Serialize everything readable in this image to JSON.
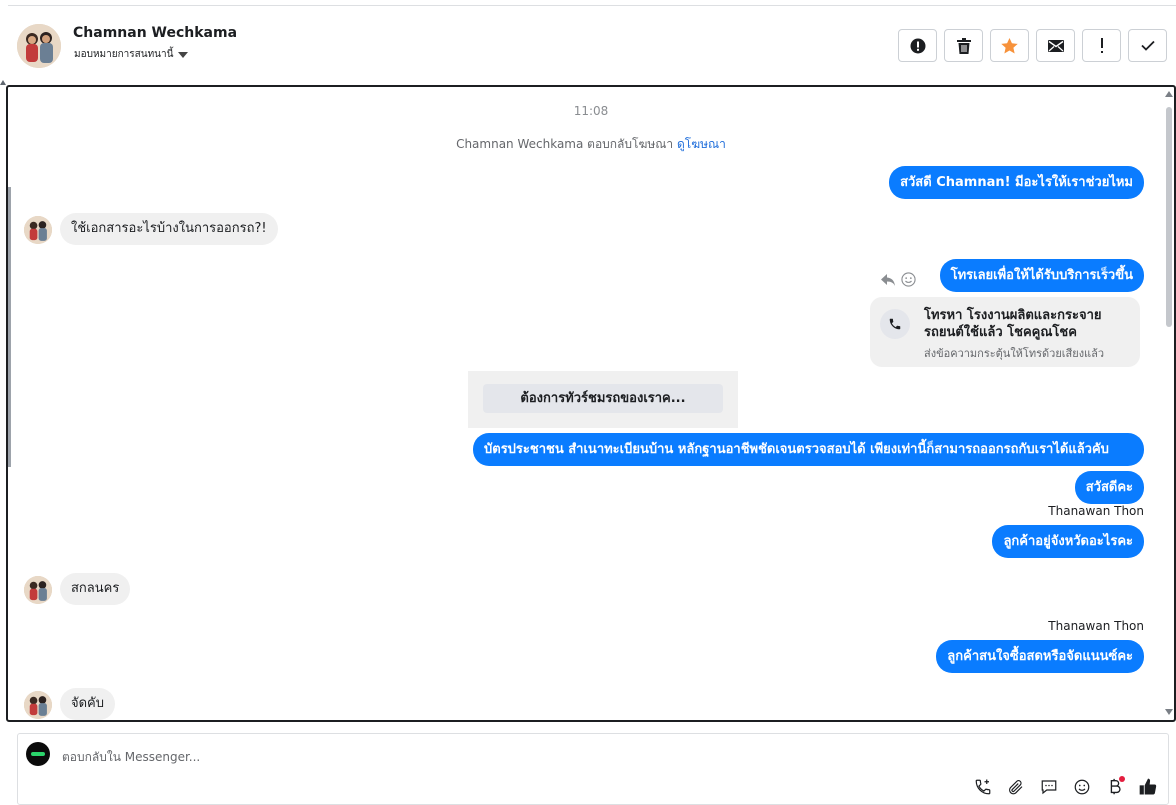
{
  "header": {
    "contact_name": "Chamnan Wechkama",
    "assign_label": "มอบหมายการสนทนานี้",
    "actions": [
      {
        "icon": "alert-circle-icon",
        "name": "mark-spam-button"
      },
      {
        "icon": "trash-icon",
        "name": "delete-button"
      },
      {
        "icon": "star-icon",
        "name": "star-button"
      },
      {
        "icon": "envelope-icon",
        "name": "mark-unread-button"
      },
      {
        "icon": "exclamation-icon",
        "name": "follow-up-button"
      },
      {
        "icon": "check-icon",
        "name": "mark-done-button"
      }
    ],
    "star_color": "#f7923b"
  },
  "conversation": {
    "timestamp": "11:08",
    "ad_reply_text": "Chamnan Wechkama ตอบกลับโฆษณา",
    "ad_link": "ดูโฆษณา",
    "messages": {
      "greeting": "สวัสดี Chamnan! มีอะไรให้เราช่วยไหม",
      "q_documents": "ใช้เอกสารอะไรบ้างในการออกรถ?!",
      "call_prompt": "โทรเลยเพื่อให้ได้รับบริการเร็วขึ้น",
      "call_card_title": "โทรหา โรงงานผลิตและกระจายรถยนต์ใช้แล้ว โชคคูณโชค",
      "call_card_sub": "ส่งข้อความกระตุ้นให้โทรด้วยเสียงแล้ว",
      "tour_button": "ต้องการทัวร์ชมรถของเราค...",
      "answer_docs": "บัตรประชาชน สำเนาทะเบียนบ้าน หลักฐานอาชีพชัดเจนตรวจสอบได้ เพียงเท่านี้ก็สามารถออกรถกับเราได้แล้วคับ",
      "hello_ka": "สวัสดีคะ",
      "sender_1": "Thanawan Thon",
      "ask_province": "ลูกค้าอยู่จังหวัดอะไรคะ",
      "reply_province": "สกลนคร",
      "sender_2": "Thanawan Thon",
      "ask_payment": "ลูกค้าสนใจซื้อสดหรือจัดแนนซ์คะ",
      "reply_payment": "จัดคับ"
    },
    "accent_color": "#0a7cff"
  },
  "composer": {
    "placeholder": "ตอบกลับใน Messenger...",
    "tools": [
      "phone-plus-icon",
      "paperclip-icon",
      "chat-icon",
      "emoji-icon",
      "baht-icon",
      "thumbs-up-icon"
    ]
  }
}
